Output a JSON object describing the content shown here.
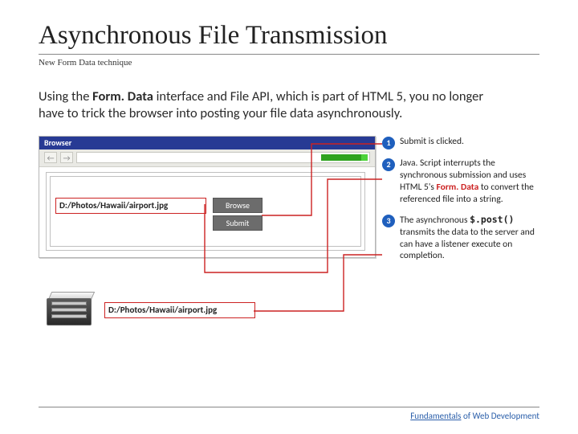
{
  "title": "Asynchronous File Transmission",
  "subtitle": "New Form Data technique",
  "body": {
    "pre": "Using the ",
    "bold": "Form. Data",
    "post": " interface and File API, which is part of HTML 5, you no longer have to trick the browser into posting your file data asynchronously."
  },
  "browser": {
    "title": "Browser",
    "nav_back": "←",
    "nav_fwd": "→",
    "file_path": "D:/Photos/Hawaii/airport.jpg",
    "browse_label": "Browse",
    "submit_label": "Submit"
  },
  "server": {
    "file_path": "D:/Photos/Hawaii/airport.jpg"
  },
  "callouts": [
    {
      "n": "1",
      "text": "Submit is clicked."
    },
    {
      "n": "2",
      "pre": "Java. Script interrupts the synchronous submission and uses HTML 5's ",
      "kw": "Form. Data",
      "post": " to convert the referenced file into a string."
    },
    {
      "n": "3",
      "pre": "The asynchronous ",
      "mono": "$.post()",
      "post": " transmits the data to the server and can have a listener execute on completion."
    }
  ],
  "footer": {
    "word1": "Fundamentals",
    "rest": " of Web Development"
  }
}
